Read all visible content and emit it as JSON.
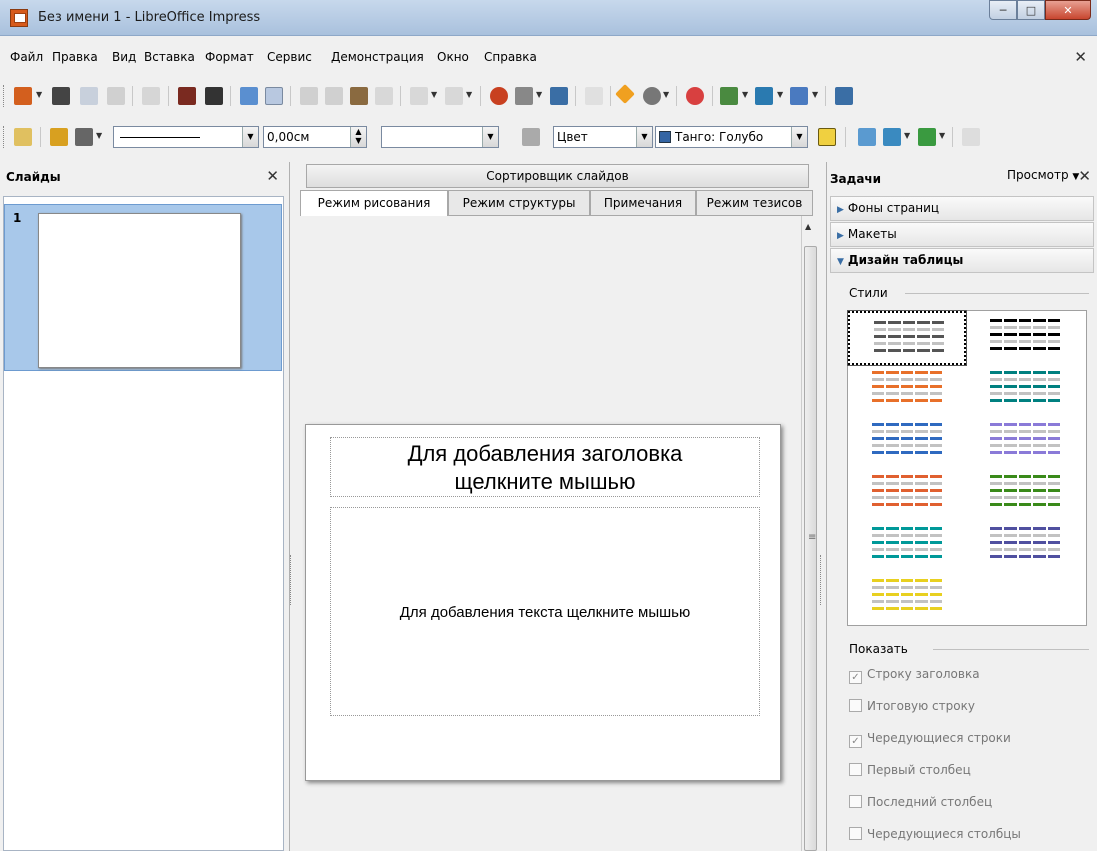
{
  "window": {
    "title": "Без имени 1 - LibreOffice Impress"
  },
  "menu": {
    "items": [
      "Файл",
      "Правка",
      "Вид",
      "Вставка",
      "Формат",
      "Сервис",
      "Демонстрация",
      "Окно",
      "Справка"
    ]
  },
  "toolbar2": {
    "line_width": "0,00см",
    "area_style": "Цвет",
    "area_color": "Танго: Голубо"
  },
  "slides_panel": {
    "title": "Слайды",
    "slides": [
      {
        "number": "1"
      }
    ]
  },
  "center": {
    "sorter_label": "Сортировщик слайдов",
    "tabs": [
      "Режим рисования",
      "Режим структуры",
      "Примечания",
      "Режим тезисов"
    ],
    "active_tab": "Режим рисования",
    "slide": {
      "title_placeholder_line1": "Для добавления заголовка",
      "title_placeholder_line2": "щелкните мышью",
      "body_placeholder": "Для добавления текста щелкните мышью"
    }
  },
  "tasks_panel": {
    "title": "Задачи",
    "view_menu": "Просмотр",
    "sections": [
      {
        "label": "Фоны страниц",
        "open": false
      },
      {
        "label": "Макеты",
        "open": false
      },
      {
        "label": "Дизайн таблицы",
        "open": true
      }
    ],
    "styles_label": "Стили",
    "show_label": "Показать",
    "table_style_colors": [
      [
        "#555555",
        "#000000"
      ],
      [
        "#e8702a",
        "#008080"
      ],
      [
        "#2f6ac0",
        "#8a7ad8"
      ],
      [
        "#e06030",
        "#3a8a1a"
      ],
      [
        "#009999",
        "#5050a0"
      ],
      [
        "#e8d020"
      ]
    ],
    "options": [
      {
        "label": "Строку заголовка",
        "checked": true
      },
      {
        "label": "Итоговую строку",
        "checked": false
      },
      {
        "label": "Чередующиеся строки",
        "checked": true
      },
      {
        "label": "Первый столбец",
        "checked": false
      },
      {
        "label": "Последний столбец",
        "checked": false
      },
      {
        "label": "Чередующиеся столбцы",
        "checked": false
      }
    ]
  }
}
